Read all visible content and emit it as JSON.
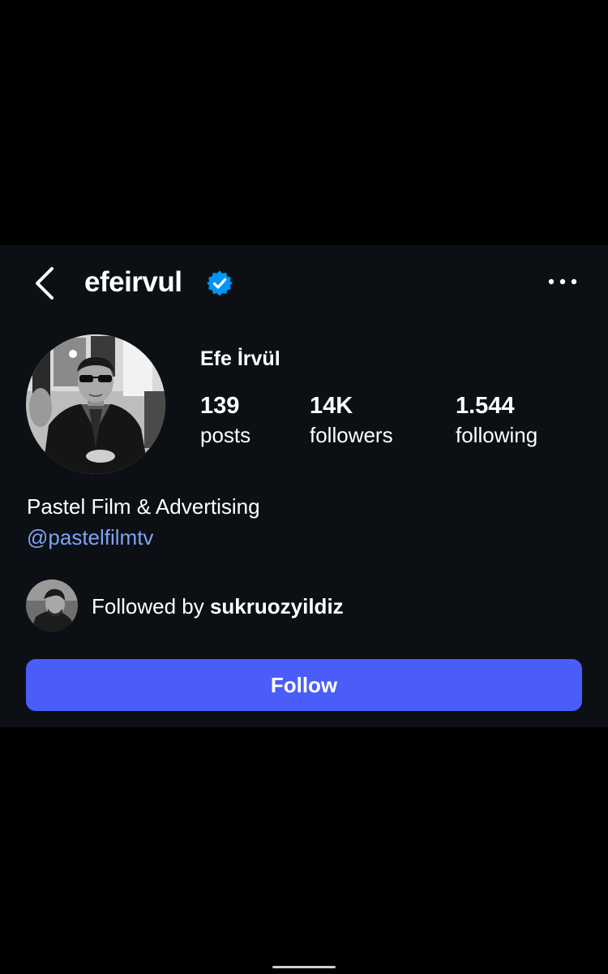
{
  "header": {
    "username": "efeirvul",
    "back_icon": "chevron-left-icon",
    "verified_icon": "verified-badge-icon",
    "more_icon": "more-horizontal-icon"
  },
  "profile": {
    "display_name": "Efe İrvül",
    "stats": {
      "posts_value": "139",
      "posts_label": "posts",
      "followers_value": "14K",
      "followers_label": "followers",
      "following_value": "1.544",
      "following_label": "following"
    },
    "bio": "Pastel Film & Advertising",
    "bio_link": "@pastelfilmtv"
  },
  "mutual": {
    "prefix": "Followed by ",
    "name": "sukruozyildiz"
  },
  "actions": {
    "follow_label": "Follow"
  },
  "colors": {
    "page_background": "#000000",
    "card_background": "#0c1014",
    "accent_blue": "#4a5df9",
    "link_blue": "#7fa2f2",
    "verified_blue": "#0095f6"
  }
}
